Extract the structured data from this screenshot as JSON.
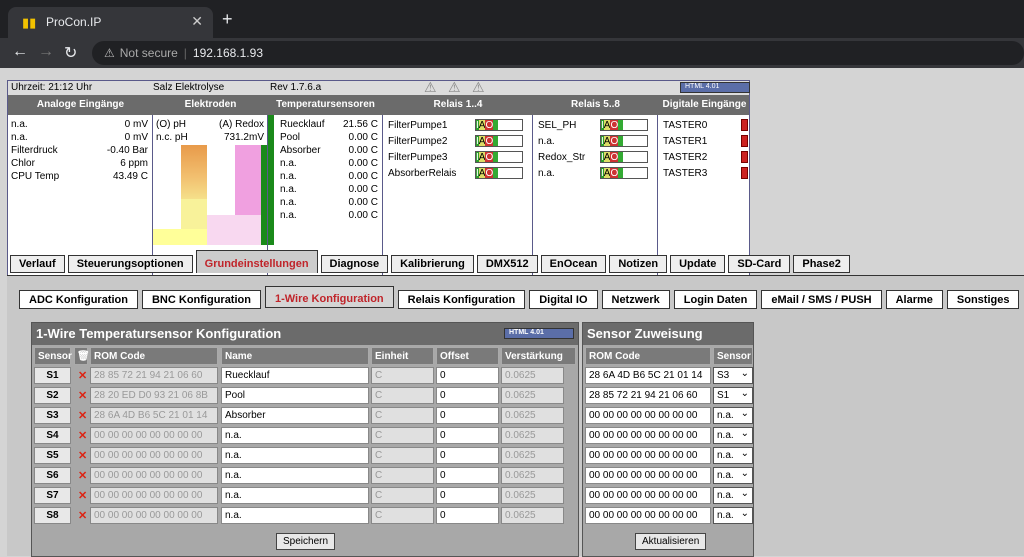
{
  "browser": {
    "tab_title": "ProCon.IP",
    "address": "192.168.1.93",
    "not_secure": "Not secure"
  },
  "status": {
    "time": "Uhrzeit: 21:12 Uhr",
    "mode": "Salz Elektrolyse",
    "rev": "Rev 1.7.6.a",
    "valid_badge": "HTML 4.01",
    "headers": [
      "Analoge Eingänge",
      "Elektroden",
      "Temperatursensoren",
      "Relais 1..4",
      "Relais 5..8",
      "Digitale Eingänge"
    ],
    "analog": [
      [
        "n.a.",
        "0 mV"
      ],
      [
        "n.a.",
        "0 mV"
      ],
      [
        "Filterdruck",
        "-0.40 Bar"
      ],
      [
        "Chlor",
        "6 ppm"
      ],
      [
        "CPU Temp",
        "43.49 C"
      ]
    ],
    "electrodes": [
      [
        "(O) pH",
        "(A) Redox"
      ],
      [
        "n.c. pH",
        "731.2mV"
      ]
    ],
    "temps": [
      [
        "Ruecklauf",
        "21.56 C"
      ],
      [
        "Pool",
        "0.00 C"
      ],
      [
        "Absorber",
        "0.00 C"
      ],
      [
        "n.a.",
        "0.00 C"
      ],
      [
        "n.a.",
        "0.00 C"
      ],
      [
        "n.a.",
        "0.00 C"
      ],
      [
        "n.a.",
        "0.00 C"
      ],
      [
        "n.a.",
        "0.00 C"
      ]
    ],
    "relais1": [
      "FilterPumpe1",
      "FilterPumpe2",
      "FilterPumpe3",
      "AbsorberRelais"
    ],
    "relais2": [
      "SEL_PH",
      "n.a.",
      "Redox_Str",
      "n.a."
    ],
    "digital": [
      "TASTER0",
      "TASTER1",
      "TASTER2",
      "TASTER3"
    ],
    "io_labels": [
      "I",
      "A",
      "O"
    ]
  },
  "main_tabs": [
    "Verlauf",
    "Steuerungsoptionen",
    "Grundeinstellungen",
    "Diagnose",
    "Kalibrierung",
    "DMX512",
    "EnOcean",
    "Notizen",
    "Update",
    "SD-Card",
    "Phase2"
  ],
  "sub_tabs": [
    "ADC Konfiguration",
    "BNC Konfiguration",
    "1-Wire Konfiguration",
    "Relais Konfiguration",
    "Digital IO",
    "Netzwerk",
    "Login Daten",
    "eMail / SMS / PUSH",
    "Alarme",
    "Sonstiges"
  ],
  "onewire": {
    "title": "1-Wire Temperatursensor Konfiguration",
    "valid_badge": "HTML 4.01",
    "headers": {
      "sensor": "Sensor",
      "rom": "ROM Code",
      "name": "Name",
      "unit": "Einheit",
      "offset": "Offset",
      "gain": "Verstärkung"
    },
    "rows": [
      {
        "s": "S1",
        "rom": "28 85 72 21 94 21 06 60",
        "name": "Ruecklauf",
        "unit": "C",
        "offset": "0",
        "gain": "0.0625"
      },
      {
        "s": "S2",
        "rom": "28 20 ED D0 93 21 06 8B",
        "name": "Pool",
        "unit": "C",
        "offset": "0",
        "gain": "0.0625"
      },
      {
        "s": "S3",
        "rom": "28 6A 4D B6 5C 21 01 14",
        "name": "Absorber",
        "unit": "C",
        "offset": "0",
        "gain": "0.0625"
      },
      {
        "s": "S4",
        "rom": "00 00 00 00 00 00 00 00",
        "name": "n.a.",
        "unit": "C",
        "offset": "0",
        "gain": "0.0625"
      },
      {
        "s": "S5",
        "rom": "00 00 00 00 00 00 00 00",
        "name": "n.a.",
        "unit": "C",
        "offset": "0",
        "gain": "0.0625"
      },
      {
        "s": "S6",
        "rom": "00 00 00 00 00 00 00 00",
        "name": "n.a.",
        "unit": "C",
        "offset": "0",
        "gain": "0.0625"
      },
      {
        "s": "S7",
        "rom": "00 00 00 00 00 00 00 00",
        "name": "n.a.",
        "unit": "C",
        "offset": "0",
        "gain": "0.0625"
      },
      {
        "s": "S8",
        "rom": "00 00 00 00 00 00 00 00",
        "name": "n.a.",
        "unit": "C",
        "offset": "0",
        "gain": "0.0625"
      }
    ],
    "save": "Speichern"
  },
  "assign": {
    "title": "Sensor Zuweisung",
    "h_rom": "ROM Code",
    "h_sensor": "Sensor",
    "rows": [
      [
        "28 6A 4D B6 5C 21 01 14",
        "S3"
      ],
      [
        "28 85 72 21 94 21 06 60",
        "S1"
      ],
      [
        "00 00 00 00 00 00 00 00",
        "n.a."
      ],
      [
        "00 00 00 00 00 00 00 00",
        "n.a."
      ],
      [
        "00 00 00 00 00 00 00 00",
        "n.a."
      ],
      [
        "00 00 00 00 00 00 00 00",
        "n.a."
      ],
      [
        "00 00 00 00 00 00 00 00",
        "n.a."
      ],
      [
        "00 00 00 00 00 00 00 00",
        "n.a."
      ]
    ],
    "refresh": "Aktualisieren"
  }
}
